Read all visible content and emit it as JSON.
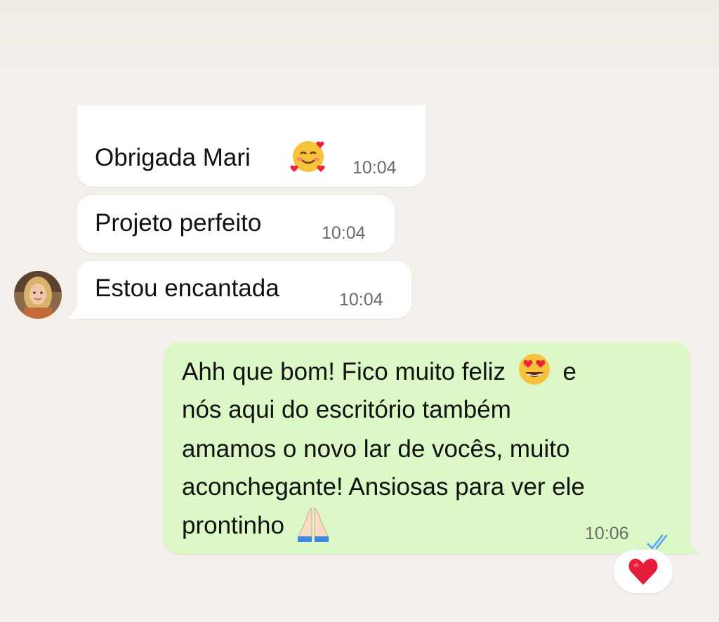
{
  "messages": [
    {
      "text": "Obrigada Mari",
      "emoji": "smiling-face-with-hearts",
      "time": "10:04",
      "direction": "incoming"
    },
    {
      "text": "Projeto perfeito",
      "time": "10:04",
      "direction": "incoming"
    },
    {
      "text": "Estou encantada",
      "time": "10:04",
      "direction": "incoming"
    },
    {
      "lines": [
        "Ahh que bom! Fico muito feliz",
        "e",
        "nós aqui do escritório também",
        "amamos o novo lar de vocês, muito",
        "aconchegante! Ansiosas para ver ele",
        "prontinho"
      ],
      "emojis": [
        "smiling-face-with-heart-eyes",
        "folded-hands"
      ],
      "time": "10:06",
      "status": "read",
      "direction": "outgoing"
    }
  ],
  "reaction": {
    "emoji": "red-heart"
  },
  "colors": {
    "background": "#f3f0eb",
    "incoming_bubble": "#ffffff",
    "outgoing_bubble": "#dcf8c6",
    "read_ticks": "#4fa6f2",
    "time_text": "#6b6b6b"
  }
}
